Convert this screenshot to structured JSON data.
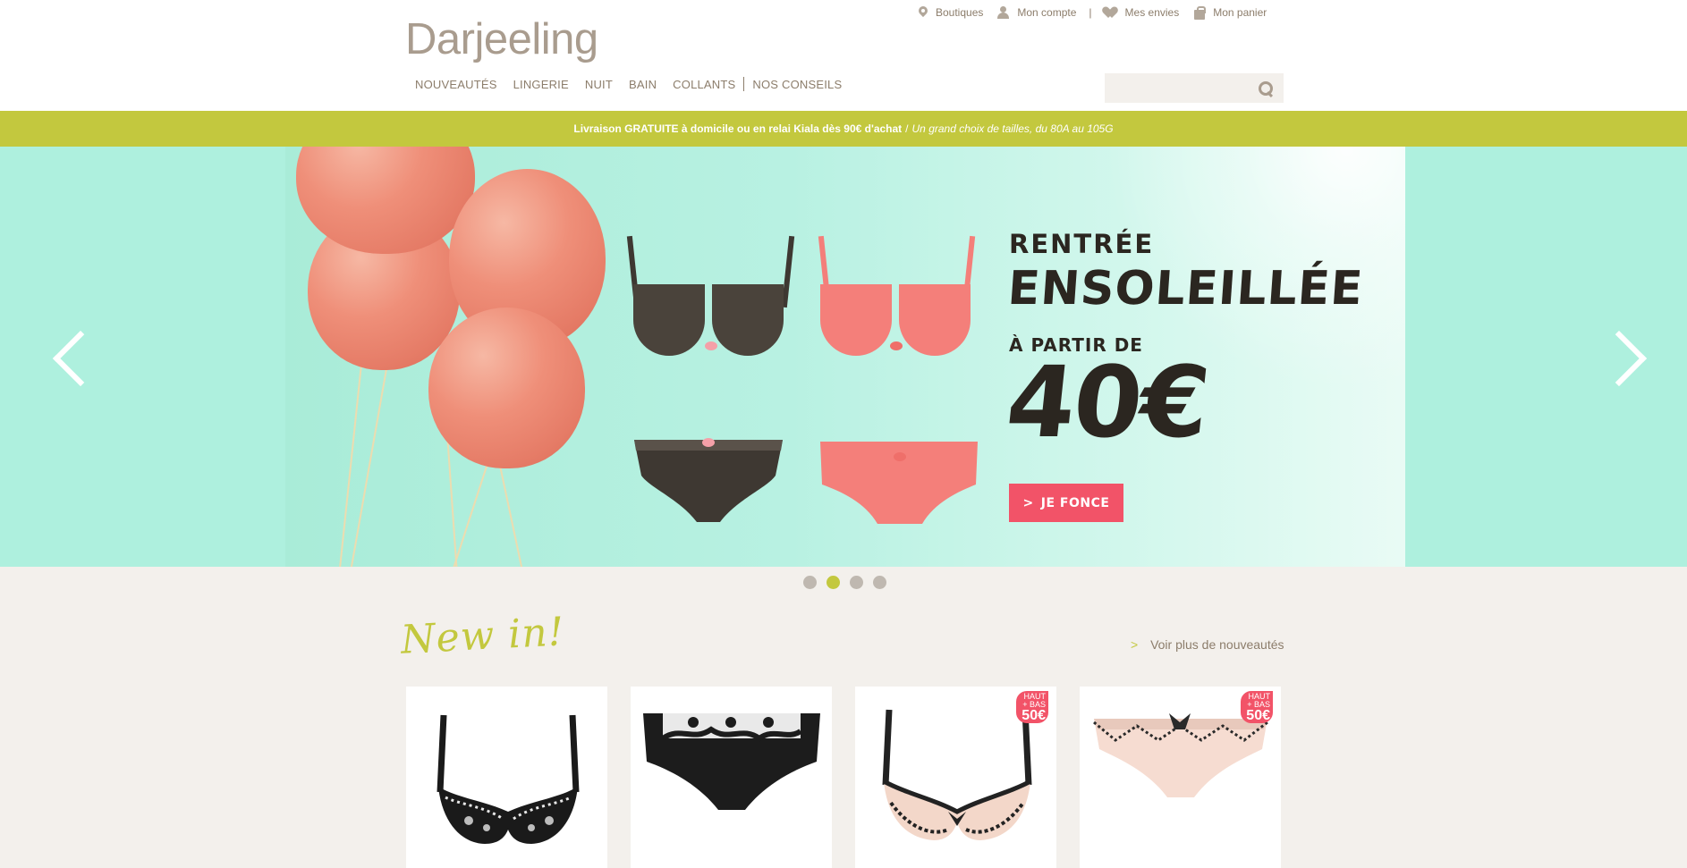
{
  "brand": {
    "logo": "Darjeeling"
  },
  "utility": {
    "stores": "Boutiques",
    "account": "Mon compte",
    "separator": "|",
    "wishlist": "Mes envies",
    "cart": "Mon panier"
  },
  "nav": {
    "items": [
      "NOUVEAUTÉS",
      "LINGERIE",
      "NUIT",
      "BAIN",
      "COLLANTS",
      "NOS CONSEILS"
    ]
  },
  "search": {
    "value": "",
    "placeholder": ""
  },
  "promo": {
    "bold": "Livraison GRATUITE à domicile ou en relai Kiala dès 90€ d'achat",
    "separator": "/",
    "italic": "Un grand choix de tailles, du 80A au 105G"
  },
  "hero": {
    "line1": "RENTRÉE",
    "line2": "ENSOLEILLÉE",
    "line3": "À PARTIR DE",
    "price": "40€",
    "cta": "JE FONCE",
    "cta_chevron": ">",
    "slide_count": 4,
    "active_slide": 2
  },
  "newin": {
    "title": "New in!",
    "more_arrow": ">",
    "more_link": "Voir plus de nouveautés"
  },
  "products": [
    {
      "name": "black-lace-bra",
      "badge": false
    },
    {
      "name": "black-lace-shorty",
      "badge": false
    },
    {
      "name": "nude-bra",
      "badge": true,
      "badge_top": "HAUT",
      "badge_mid": "+ BAS",
      "badge_price": "50€"
    },
    {
      "name": "nude-panty",
      "badge": true,
      "badge_top": "HAUT",
      "badge_mid": "+ BAS",
      "badge_price": "50€"
    }
  ],
  "colors": {
    "accent_green": "#c3c83e",
    "cta_pink": "#f25368",
    "text_brown": "#8c7d6b",
    "hero_bg": "#aef0de",
    "page_bg": "#f3f0ec"
  }
}
